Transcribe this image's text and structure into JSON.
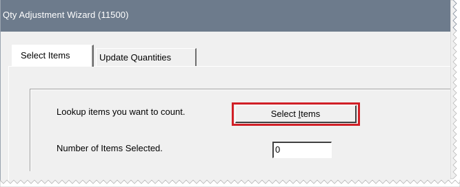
{
  "window": {
    "title": "Qty Adjustment Wizard (11500)"
  },
  "tabs": [
    {
      "label": "Select Items",
      "active": true
    },
    {
      "label": "Update Quantities",
      "active": false
    }
  ],
  "select_items_page": {
    "lookup_label": "Lookup items you want to count.",
    "select_button": {
      "before": "Select ",
      "mnemonic": "I",
      "after": "tems",
      "highlight_color": "#d11f26"
    },
    "count_label": "Number of Items Selected.",
    "count_value": "0"
  }
}
